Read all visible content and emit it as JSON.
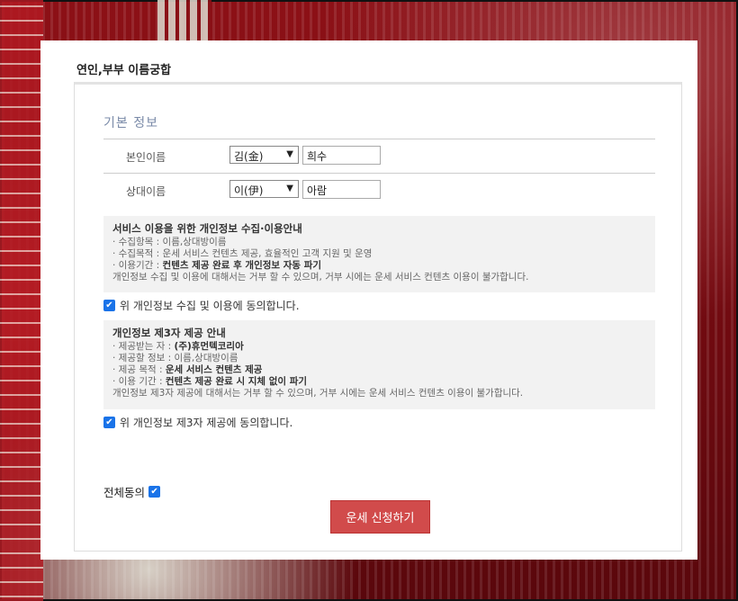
{
  "card": {
    "title": "연인,부부 이름궁합"
  },
  "form": {
    "section_title": "기본 정보",
    "self": {
      "label": "본인이름",
      "surname": "김(金)",
      "name": "희수"
    },
    "partner": {
      "label": "상대이름",
      "surname": "이(伊)",
      "name": "아람"
    }
  },
  "privacy": {
    "title": "서비스 이용을 위한 개인정보 수집·이용안내",
    "line1": "· 수집항목 : 이름,상대방이름",
    "line2": "· 수집목적 : 운세 서비스 컨텐츠 제공, 효율적인 고객 지원 및 운영",
    "line3_prefix": "· 이용기간 : ",
    "line3_bold": "컨텐츠 제공 완료 후 개인정보 자동 파기",
    "line4": "개인정보 수집 및 이용에 대해서는 거부 할 수 있으며, 거부 시에는 운세 서비스 컨텐츠 이용이 불가합니다.",
    "agree_label": "위 개인정보 수집 및 이용에 동의합니다."
  },
  "third_party": {
    "title": "개인정보 제3자 제공 안내",
    "line1_prefix": "· 제공받는 자 : ",
    "line1_bold": "(주)휴먼텍코리아",
    "line2": "· 제공할 정보 : 이름,상대방이름",
    "line3_prefix": "· 제공 목적 : ",
    "line3_bold": "운세 서비스 컨텐츠 제공",
    "line4_prefix": "· 이용 기간 : ",
    "line4_bold": "컨텐츠 제공 완료 시 지체 없이 파기",
    "line5": "개인정보 제3자 제공에 대해서는 거부 할 수 있으며, 거부 시에는 운세 서비스 컨텐츠 이용이 불가합니다.",
    "agree_label": "위 개인정보 제3자 제공에 동의합니다."
  },
  "all_agree": {
    "label": "전체동의"
  },
  "submit": {
    "label": "운세 신청하기"
  },
  "colors": {
    "accent": "#d14b4b",
    "checkbox": "#1a73e8",
    "section_title": "#7a8aa8"
  }
}
